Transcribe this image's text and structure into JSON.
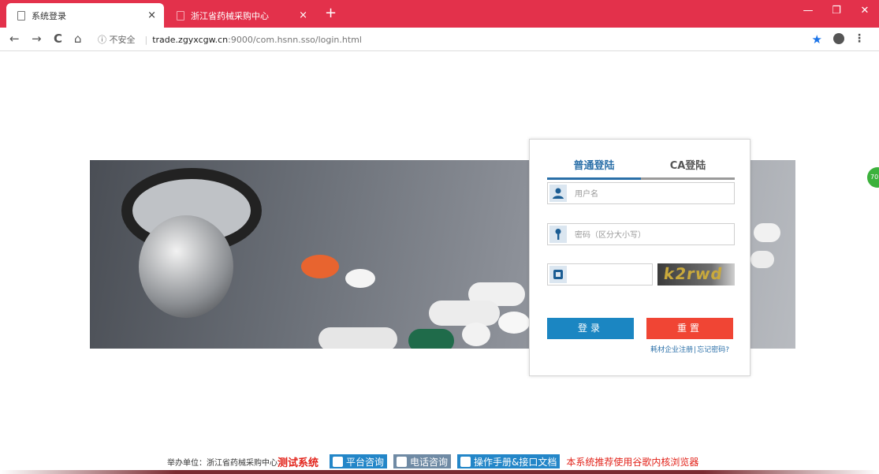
{
  "browser": {
    "tabs": [
      {
        "label": "系统登录",
        "close": "×"
      },
      {
        "label": "浙江省药械采购中心",
        "close": "×"
      }
    ],
    "new_tab": "+",
    "window_buttons": {
      "minimize": "—",
      "restore": "❐",
      "close": "✕"
    },
    "nav": {
      "back": "←",
      "forward": "→",
      "reload": "C",
      "home": "⌂"
    },
    "address": {
      "security": "ⓘ 不安全",
      "host": "trade.zgyxcgw.cn",
      "path": ":9000/com.hsnn.sso/login.html"
    },
    "star": "★",
    "menu": "⋮",
    "accent_color": "#e3314b"
  },
  "login": {
    "tabs": [
      {
        "label": "普通登陆"
      },
      {
        "label": "CA登陆"
      }
    ],
    "username_placeholder": "用户名",
    "password_placeholder": "密码（区分大小写）",
    "captcha_text": "k2rwd",
    "login_button": "登录",
    "reset_button": "重置",
    "register_link": "耗材企业注册",
    "forgot_link": "忘记密码?",
    "link_separator": "|"
  },
  "badge": "70",
  "footer": {
    "host_label": "举办单位：浙江省药械采购中心",
    "test_system": "测试系统",
    "platform_consult": "平台咨询",
    "phone_consult": "电话咨询",
    "manual": "操作手册&接口文档",
    "recommend": "本系统推荐使用谷歌内核浏览器"
  }
}
